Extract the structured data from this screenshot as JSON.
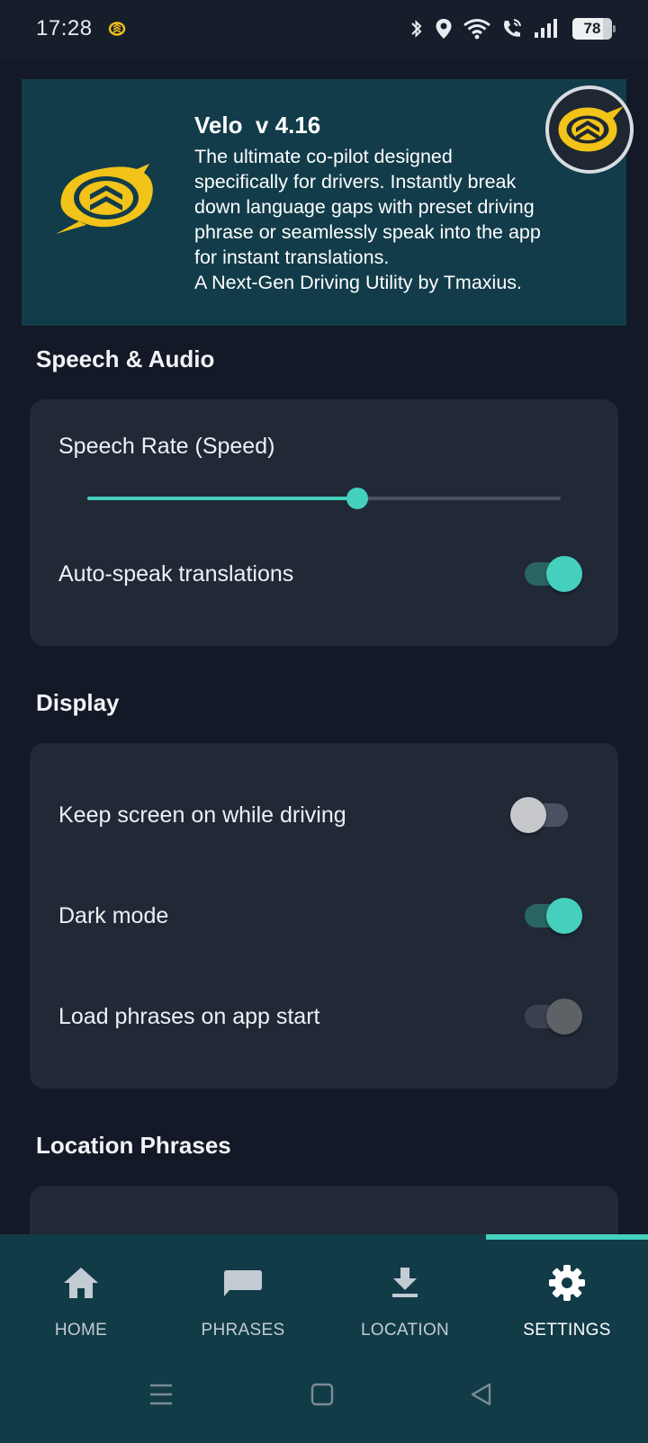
{
  "status_bar": {
    "time": "17:28",
    "battery": "78",
    "battery_level": 0.78,
    "icons": [
      "app-notification-icon",
      "bluetooth-icon",
      "location-pin-icon",
      "wifi-icon",
      "wifi-calling-icon",
      "signal-icon",
      "battery-icon"
    ]
  },
  "banner": {
    "title": "Velo  v 4.16",
    "description_lines": [
      "The ultimate co-pilot designed",
      "specifically for drivers. Instantly break",
      "down language gaps with preset driving",
      "phrase or seamlessly speak into the app",
      "for instant translations.",
      "A Next-Gen Driving Utility by Tmaxius."
    ],
    "logo_colors": {
      "brand_yellow": "#F2C318",
      "banner_bg": "#123C4A"
    }
  },
  "sections": {
    "speech_audio": {
      "title": "Speech & Audio",
      "speech_rate_label": "Speech Rate (Speed)",
      "speech_rate_fraction": 0.57,
      "auto_speak_label": "Auto-speak translations",
      "auto_speak_on": true
    },
    "display": {
      "title": "Display",
      "keep_screen_label": "Keep screen on while driving",
      "keep_screen_on": false,
      "dark_mode_label": "Dark mode",
      "dark_mode_on": true,
      "load_phrases_label": "Load phrases on app start",
      "load_phrases_state": "disabled"
    },
    "location_phrases": {
      "title": "Location Phrases"
    }
  },
  "bottom_nav": {
    "active": "SETTINGS",
    "items": [
      {
        "label": "HOME",
        "icon": "home-icon"
      },
      {
        "label": "PHRASES",
        "icon": "chat-bubble-icon"
      },
      {
        "label": "LOCATION",
        "icon": "download-icon"
      },
      {
        "label": "SETTINGS",
        "icon": "gear-icon"
      }
    ]
  },
  "colors": {
    "accent": "#45D0BE",
    "background": "#131926",
    "card": "#212937",
    "nav_bg": "#123B48"
  }
}
